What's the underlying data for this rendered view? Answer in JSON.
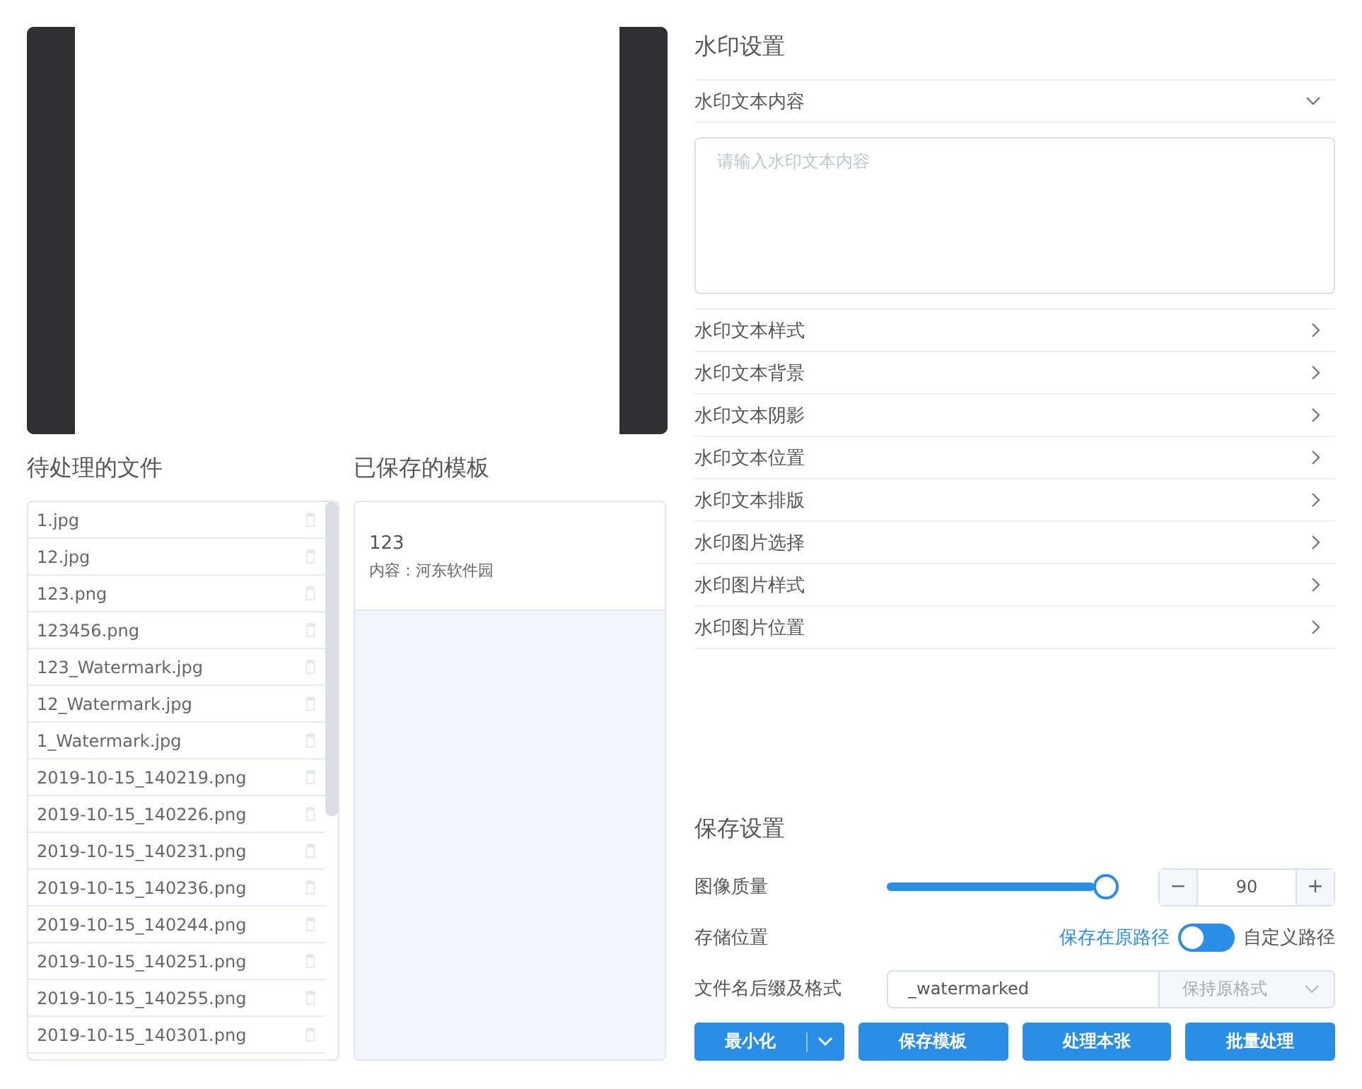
{
  "files": {
    "title": "待处理的文件",
    "items": [
      {
        "name": "1.jpg"
      },
      {
        "name": "12.jpg"
      },
      {
        "name": "123.png"
      },
      {
        "name": "123456.png"
      },
      {
        "name": "123_Watermark.jpg"
      },
      {
        "name": "12_Watermark.jpg"
      },
      {
        "name": "1_Watermark.jpg"
      },
      {
        "name": "2019-10-15_140219.png"
      },
      {
        "name": "2019-10-15_140226.png"
      },
      {
        "name": "2019-10-15_140231.png"
      },
      {
        "name": "2019-10-15_140236.png"
      },
      {
        "name": "2019-10-15_140244.png"
      },
      {
        "name": "2019-10-15_140251.png"
      },
      {
        "name": "2019-10-15_140255.png"
      },
      {
        "name": "2019-10-15_140301.png"
      }
    ]
  },
  "templates": {
    "title": "已保存的模板",
    "items": [
      {
        "name": "123",
        "content": "内容：河东软件园"
      }
    ]
  },
  "watermark_settings": {
    "title": "水印设置",
    "sections": [
      {
        "label": "水印文本内容",
        "expanded": true,
        "placeholder": "请输入水印文本内容"
      },
      {
        "label": "水印文本样式",
        "expanded": false
      },
      {
        "label": "水印文本背景",
        "expanded": false
      },
      {
        "label": "水印文本阴影",
        "expanded": false
      },
      {
        "label": "水印文本位置",
        "expanded": false
      },
      {
        "label": "水印文本排版",
        "expanded": false
      },
      {
        "label": "水印图片选择",
        "expanded": false
      },
      {
        "label": "水印图片样式",
        "expanded": false
      },
      {
        "label": "水印图片位置",
        "expanded": false
      }
    ]
  },
  "save_settings": {
    "title": "保存设置",
    "quality": {
      "label": "图像质量",
      "level": 0.9,
      "minus": "−",
      "value": "90",
      "plus": "+"
    },
    "location": {
      "label": "存储位置",
      "left_option": "保存在原路径",
      "custom_path": false,
      "right_option": "自定义路径"
    },
    "filename": {
      "label": "文件名后缀及格式",
      "suffix": "_watermarked",
      "format": "保持原格式"
    }
  },
  "buttons": [
    {
      "label": "最小化",
      "kind": "split"
    },
    {
      "label": "保存模板",
      "kind": "plain"
    },
    {
      "label": "处理本张",
      "kind": "plain"
    },
    {
      "label": "批量处理",
      "kind": "plain"
    }
  ]
}
